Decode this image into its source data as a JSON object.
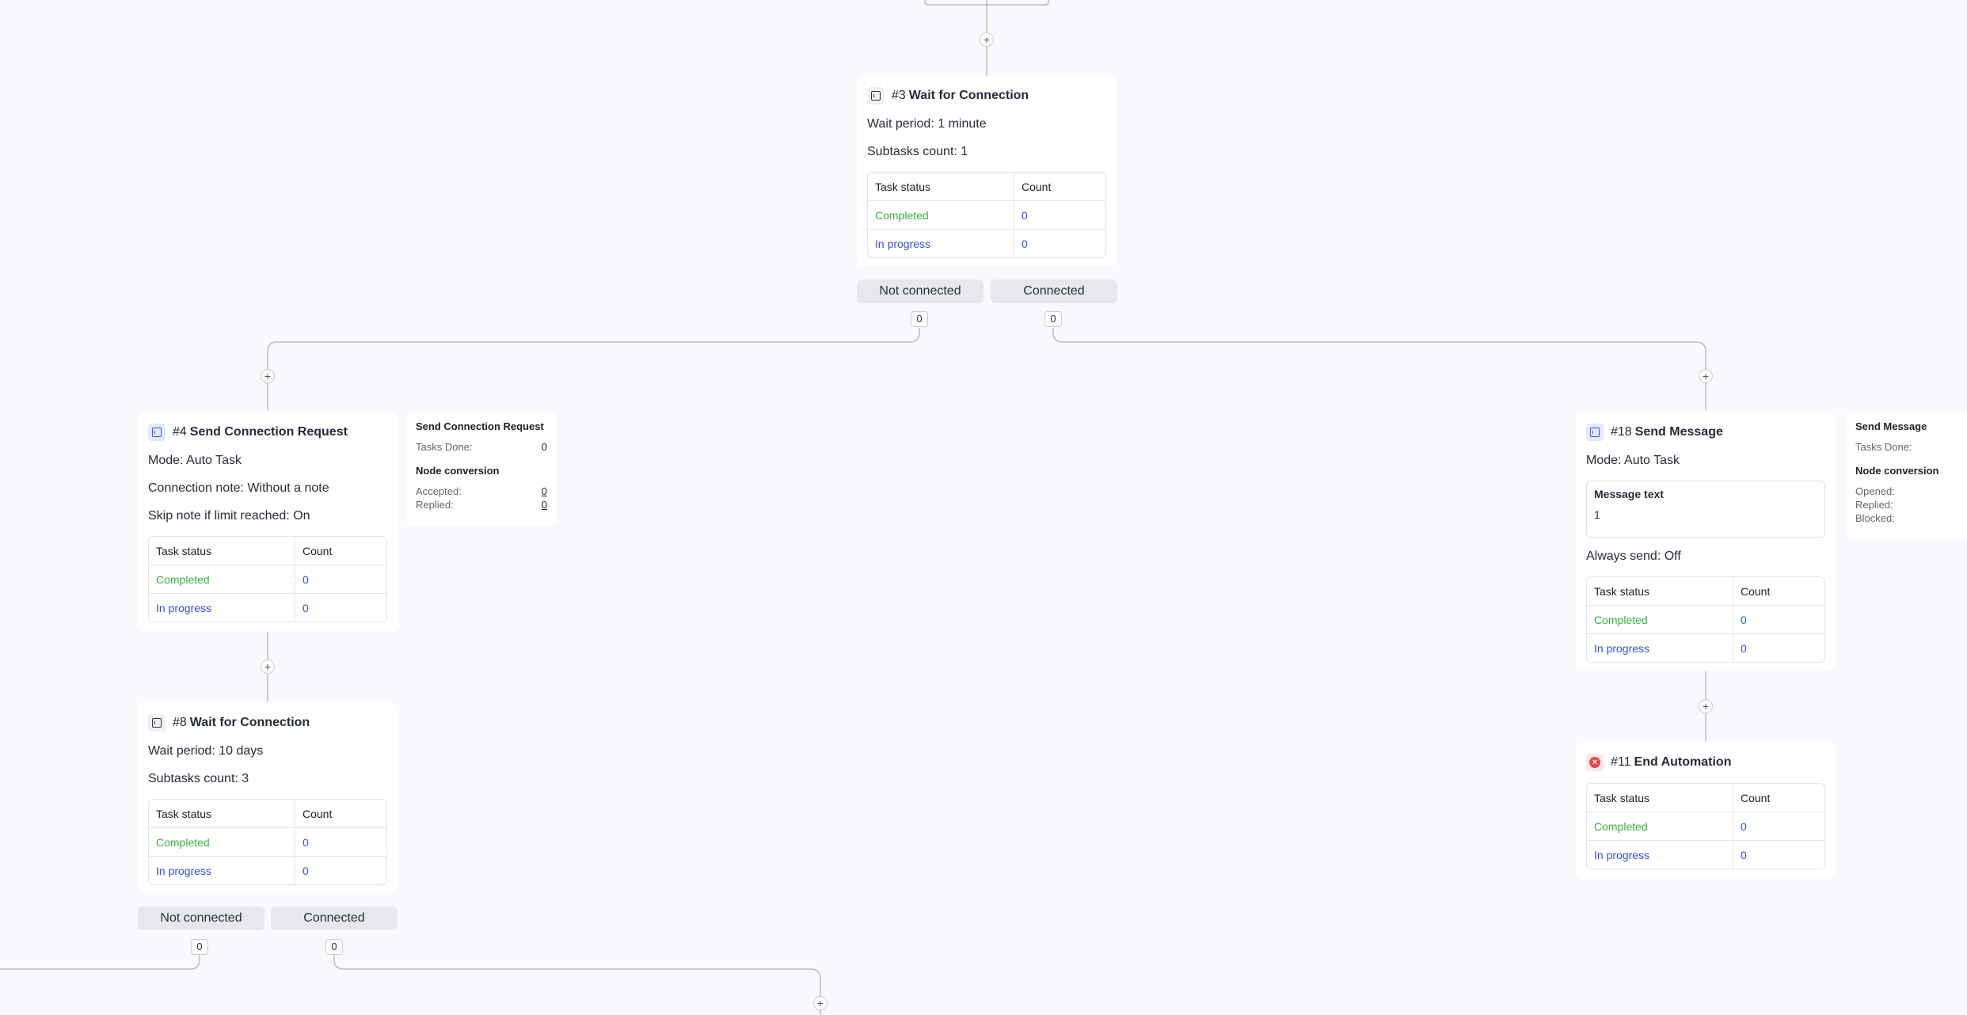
{
  "flow": {
    "nodes": {
      "n3": {
        "number": "#3",
        "title": "Wait for Connection",
        "wait_label": "Wait period:",
        "wait_value": "1 minute",
        "subtasks_label": "Subtasks count:",
        "subtasks_value": "1",
        "table": {
          "col1": "Task status",
          "col2": "Count",
          "rows": [
            {
              "status": "Completed",
              "count": "0"
            },
            {
              "status": "In progress",
              "count": "0"
            }
          ]
        }
      },
      "n4": {
        "number": "#4",
        "title": "Send Connection Request",
        "mode_label": "Mode:",
        "mode_value": "Auto Task",
        "note_label": "Connection note:",
        "note_value": "Without a note",
        "skip_label": "Skip note if limit reached:",
        "skip_value": "On",
        "table": {
          "col1": "Task status",
          "col2": "Count",
          "rows": [
            {
              "status": "Completed",
              "count": "0"
            },
            {
              "status": "In progress",
              "count": "0"
            }
          ]
        }
      },
      "n8": {
        "number": "#8",
        "title": "Wait for Connection",
        "wait_label": "Wait period:",
        "wait_value": "10 days",
        "subtasks_label": "Subtasks count:",
        "subtasks_value": "3",
        "table": {
          "col1": "Task status",
          "col2": "Count",
          "rows": [
            {
              "status": "Completed",
              "count": "0"
            },
            {
              "status": "In progress",
              "count": "0"
            }
          ]
        }
      },
      "n18": {
        "number": "#18",
        "title": "Send Message",
        "mode_label": "Mode:",
        "mode_value": "Auto Task",
        "message_label": "Message text",
        "message_value": "1",
        "always_label": "Always send:",
        "always_value": "Off",
        "table": {
          "col1": "Task status",
          "col2": "Count",
          "rows": [
            {
              "status": "Completed",
              "count": "0"
            },
            {
              "status": "In progress",
              "count": "0"
            }
          ]
        }
      },
      "n11": {
        "number": "#11",
        "title": "End Automation",
        "table": {
          "col1": "Task status",
          "col2": "Count",
          "rows": [
            {
              "status": "Completed",
              "count": "0"
            },
            {
              "status": "In progress",
              "count": "0"
            }
          ]
        }
      }
    },
    "branches": {
      "b3": {
        "not_connected": "Not connected",
        "connected": "Connected",
        "not_connected_count": "0",
        "connected_count": "0"
      },
      "b8": {
        "not_connected": "Not connected",
        "connected": "Connected",
        "not_connected_count": "0",
        "connected_count": "0"
      }
    },
    "stats": {
      "s4": {
        "title": "Send Connection Request",
        "tasks_done_label": "Tasks Done:",
        "tasks_done_value": "0",
        "conversion_title": "Node conversion",
        "accepted_label": "Accepted:",
        "accepted_value": "0",
        "replied_label": "Replied:",
        "replied_value": "0"
      },
      "s18": {
        "title": "Send Message",
        "tasks_done_label": "Tasks Done:",
        "conversion_title": "Node conversion",
        "opened_label": "Opened:",
        "replied_label": "Replied:",
        "blocked_label": "Blocked:"
      }
    },
    "add_symbol": "+"
  },
  "colors": {
    "completed": "#3cae43",
    "in_progress": "#3350d6",
    "canvas": "#f8f9fc",
    "end_icon": "#e5484d"
  },
  "icons": {
    "linkedin": "linkedin-icon",
    "wait": "calendar-icon",
    "end": "close-circle-icon"
  }
}
